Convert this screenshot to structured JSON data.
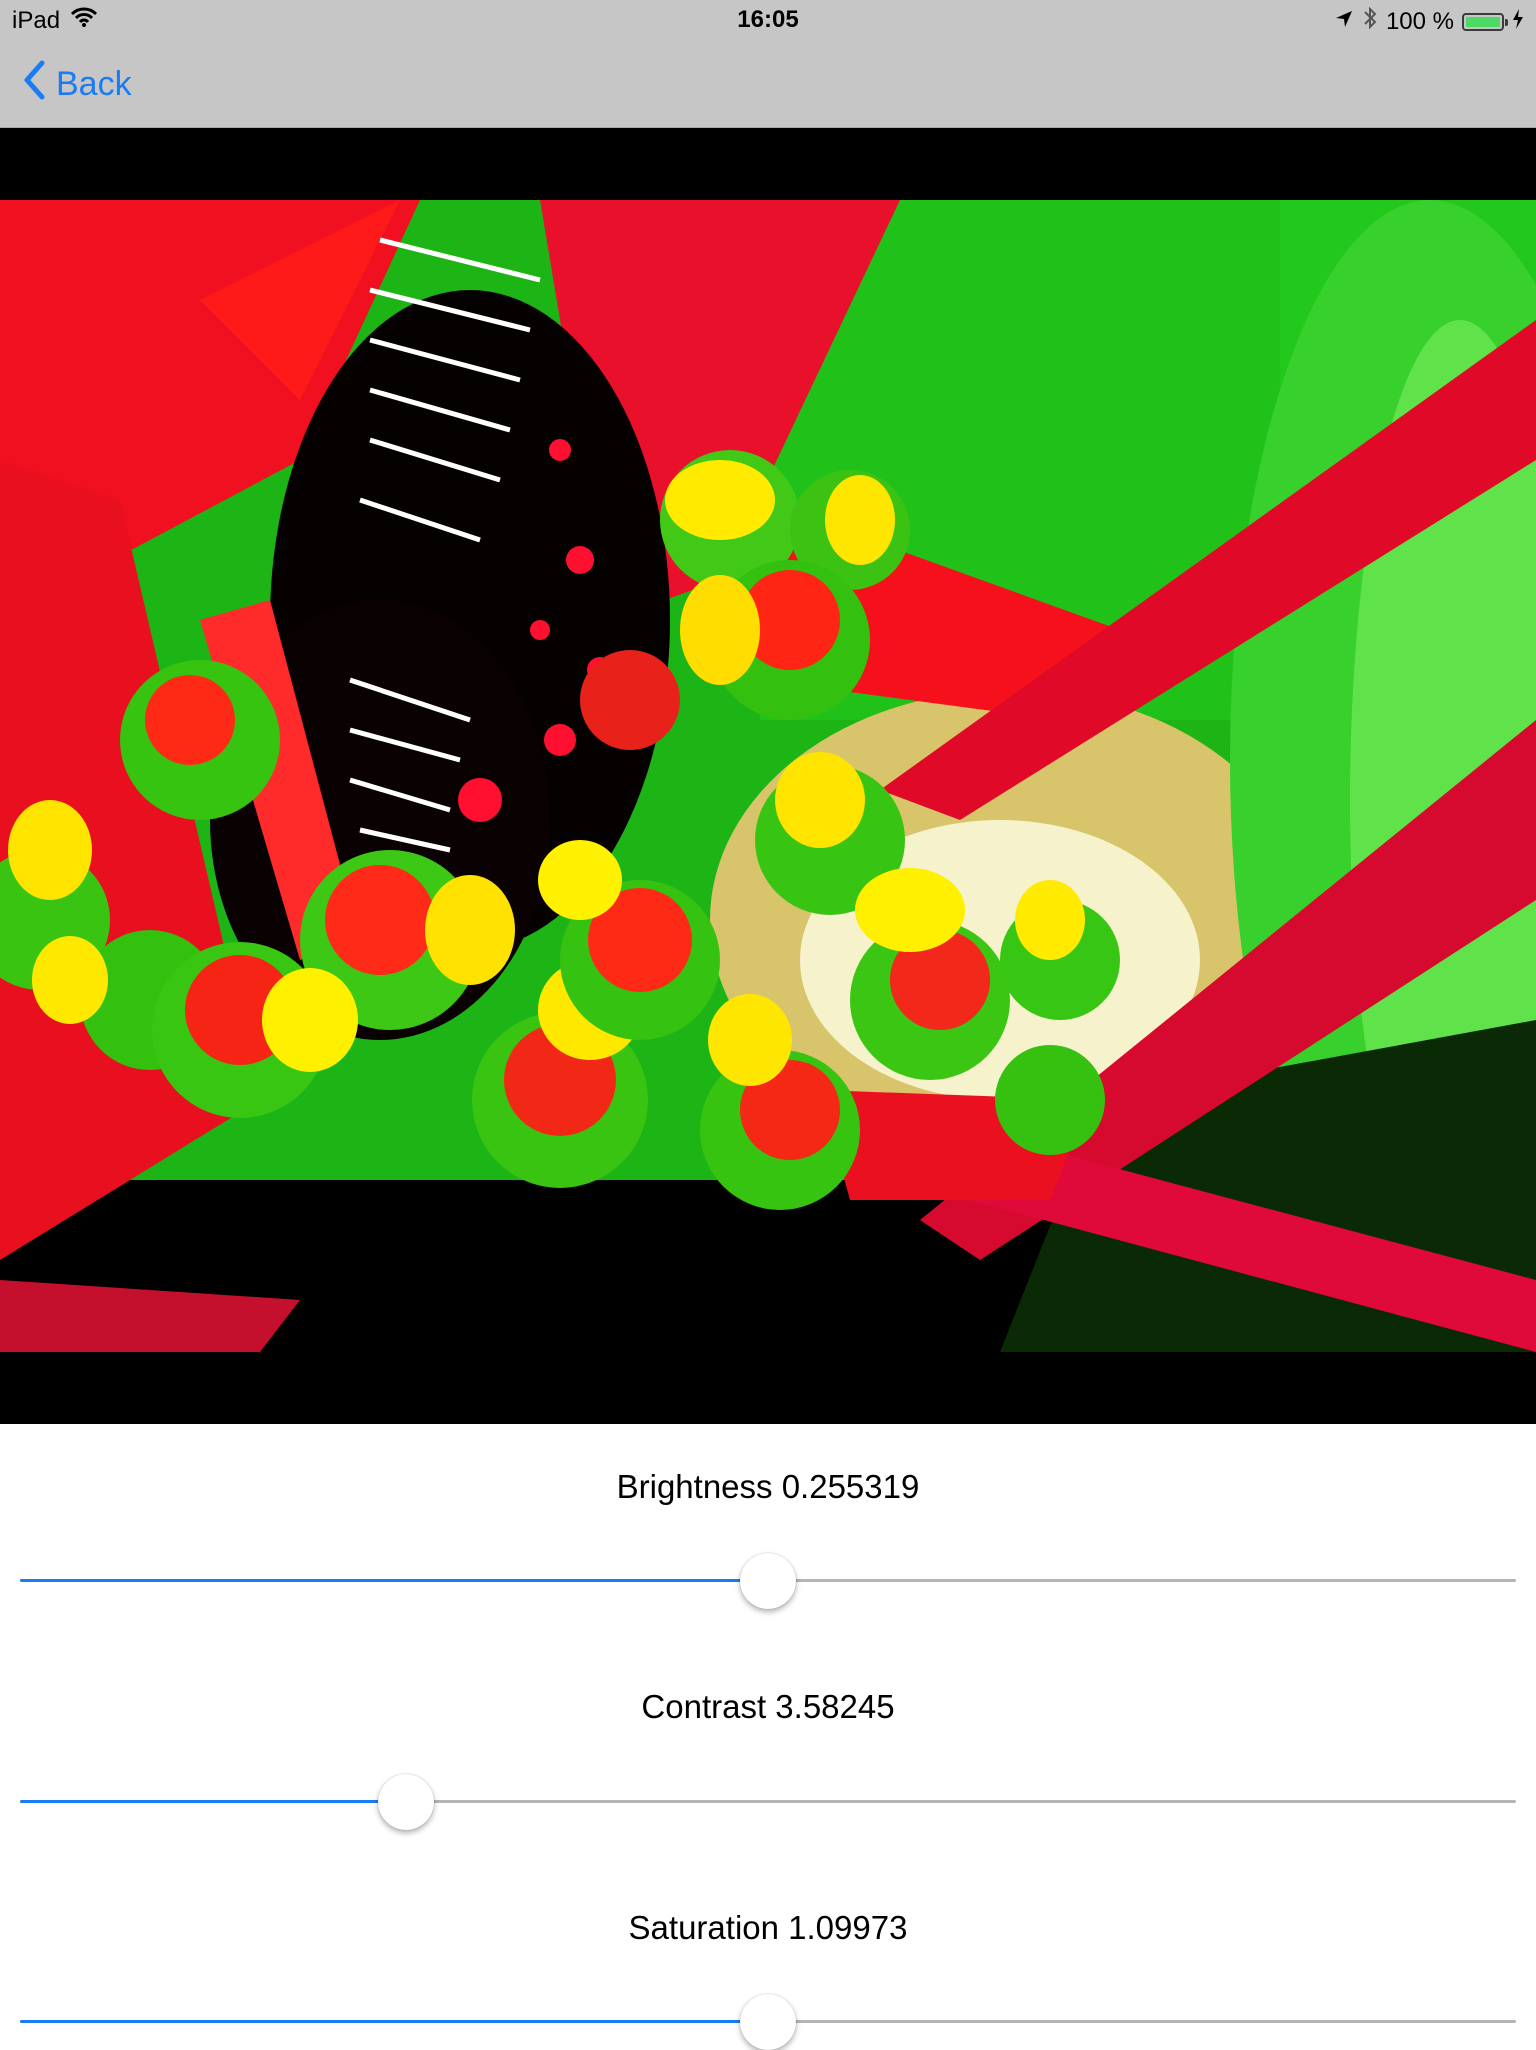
{
  "status_bar": {
    "device": "iPad",
    "time": "16:05",
    "battery_text": "100 %",
    "battery_level": 1.0,
    "icons": [
      "wifi-icon",
      "location-arrow-icon",
      "bluetooth-icon",
      "battery-icon",
      "charging-bolt-icon"
    ]
  },
  "nav": {
    "back_label": "Back",
    "accent_color": "#1a7cf5"
  },
  "photo": {
    "description_icon": "butterfly-on-flowers-photo"
  },
  "controls": {
    "brightness": {
      "label": "Brightness 0.255319",
      "fraction": 0.5
    },
    "contrast": {
      "label": "Contrast 3.58245",
      "fraction": 0.258
    },
    "saturation": {
      "label": "Saturation 1.09973",
      "fraction": 0.5
    }
  }
}
